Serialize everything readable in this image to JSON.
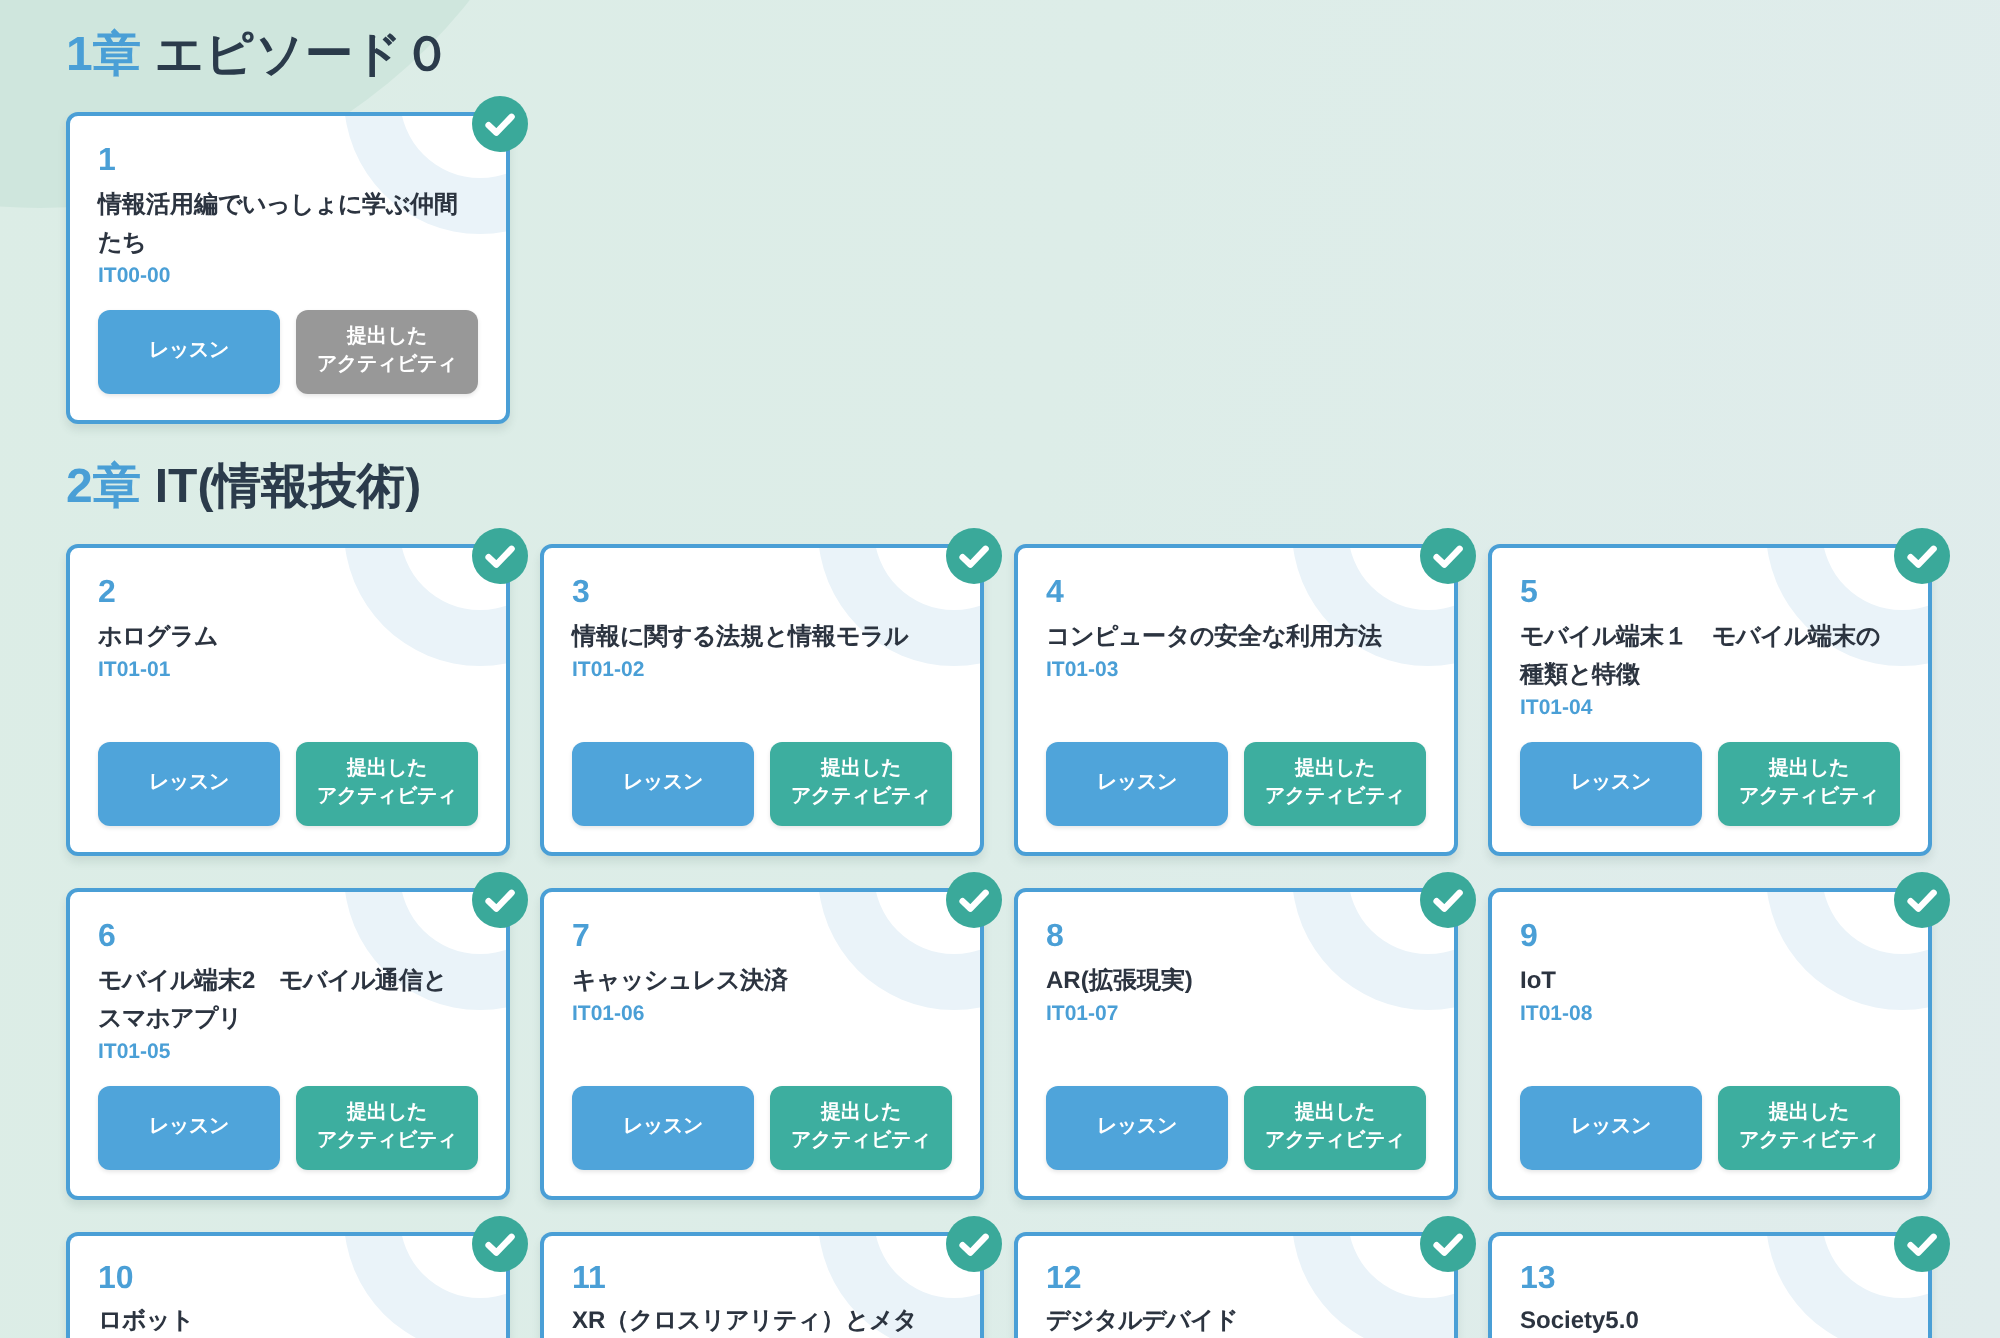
{
  "chapters": [
    {
      "number": "1章",
      "title": "エピソード０",
      "lessons": [
        {
          "number": "1",
          "title": "情報活用編でいっしょに学ぶ仲間たち",
          "code": "IT00-00",
          "completed": true,
          "buttons": [
            {
              "kind": "lesson",
              "lines": [
                "レッスン"
              ],
              "disabled": false
            },
            {
              "kind": "activity",
              "lines": [
                "提出した",
                "アクティビティ"
              ],
              "disabled": true
            }
          ]
        }
      ]
    },
    {
      "number": "2章",
      "title": "IT(情報技術)",
      "lessons": [
        {
          "number": "2",
          "title": "ホログラム",
          "code": "IT01-01",
          "completed": true,
          "buttons": [
            {
              "kind": "lesson",
              "lines": [
                "レッスン"
              ],
              "disabled": false
            },
            {
              "kind": "activity",
              "lines": [
                "提出した",
                "アクティビティ"
              ],
              "disabled": false
            }
          ]
        },
        {
          "number": "3",
          "title": "情報に関する法規と情報モラル",
          "code": "IT01-02",
          "completed": true,
          "buttons": [
            {
              "kind": "lesson",
              "lines": [
                "レッスン"
              ],
              "disabled": false
            },
            {
              "kind": "activity",
              "lines": [
                "提出した",
                "アクティビティ"
              ],
              "disabled": false
            }
          ]
        },
        {
          "number": "4",
          "title": "コンピュータの安全な利用方法",
          "code": "IT01-03",
          "completed": true,
          "buttons": [
            {
              "kind": "lesson",
              "lines": [
                "レッスン"
              ],
              "disabled": false
            },
            {
              "kind": "activity",
              "lines": [
                "提出した",
                "アクティビティ"
              ],
              "disabled": false
            }
          ]
        },
        {
          "number": "5",
          "title": "モバイル端末１　モバイル端末の種類と特徴",
          "code": "IT01-04",
          "completed": true,
          "buttons": [
            {
              "kind": "lesson",
              "lines": [
                "レッスン"
              ],
              "disabled": false
            },
            {
              "kind": "activity",
              "lines": [
                "提出した",
                "アクティビティ"
              ],
              "disabled": false
            }
          ]
        },
        {
          "number": "6",
          "title": "モバイル端末2　モバイル通信とスマホアプリ",
          "code": "IT01-05",
          "completed": true,
          "buttons": [
            {
              "kind": "lesson",
              "lines": [
                "レッスン"
              ],
              "disabled": false
            },
            {
              "kind": "activity",
              "lines": [
                "提出した",
                "アクティビティ"
              ],
              "disabled": false
            }
          ]
        },
        {
          "number": "7",
          "title": "キャッシュレス決済",
          "code": "IT01-06",
          "completed": true,
          "buttons": [
            {
              "kind": "lesson",
              "lines": [
                "レッスン"
              ],
              "disabled": false
            },
            {
              "kind": "activity",
              "lines": [
                "提出した",
                "アクティビティ"
              ],
              "disabled": false
            }
          ]
        },
        {
          "number": "8",
          "title": "AR(拡張現実)",
          "code": "IT01-07",
          "completed": true,
          "buttons": [
            {
              "kind": "lesson",
              "lines": [
                "レッスン"
              ],
              "disabled": false
            },
            {
              "kind": "activity",
              "lines": [
                "提出した",
                "アクティビティ"
              ],
              "disabled": false
            }
          ]
        },
        {
          "number": "9",
          "title": "IoT",
          "code": "IT01-08",
          "completed": true,
          "buttons": [
            {
              "kind": "lesson",
              "lines": [
                "レッスン"
              ],
              "disabled": false
            },
            {
              "kind": "activity",
              "lines": [
                "提出した",
                "アクティビティ"
              ],
              "disabled": false
            }
          ]
        },
        {
          "number": "10",
          "title": "ロボット",
          "completed": true
        },
        {
          "number": "11",
          "title": "XR（クロスリアリティ）とメタ",
          "completed": true
        },
        {
          "number": "12",
          "title": "デジタルデバイド",
          "completed": true
        },
        {
          "number": "13",
          "title": "Society5.0",
          "completed": true
        }
      ]
    }
  ]
}
